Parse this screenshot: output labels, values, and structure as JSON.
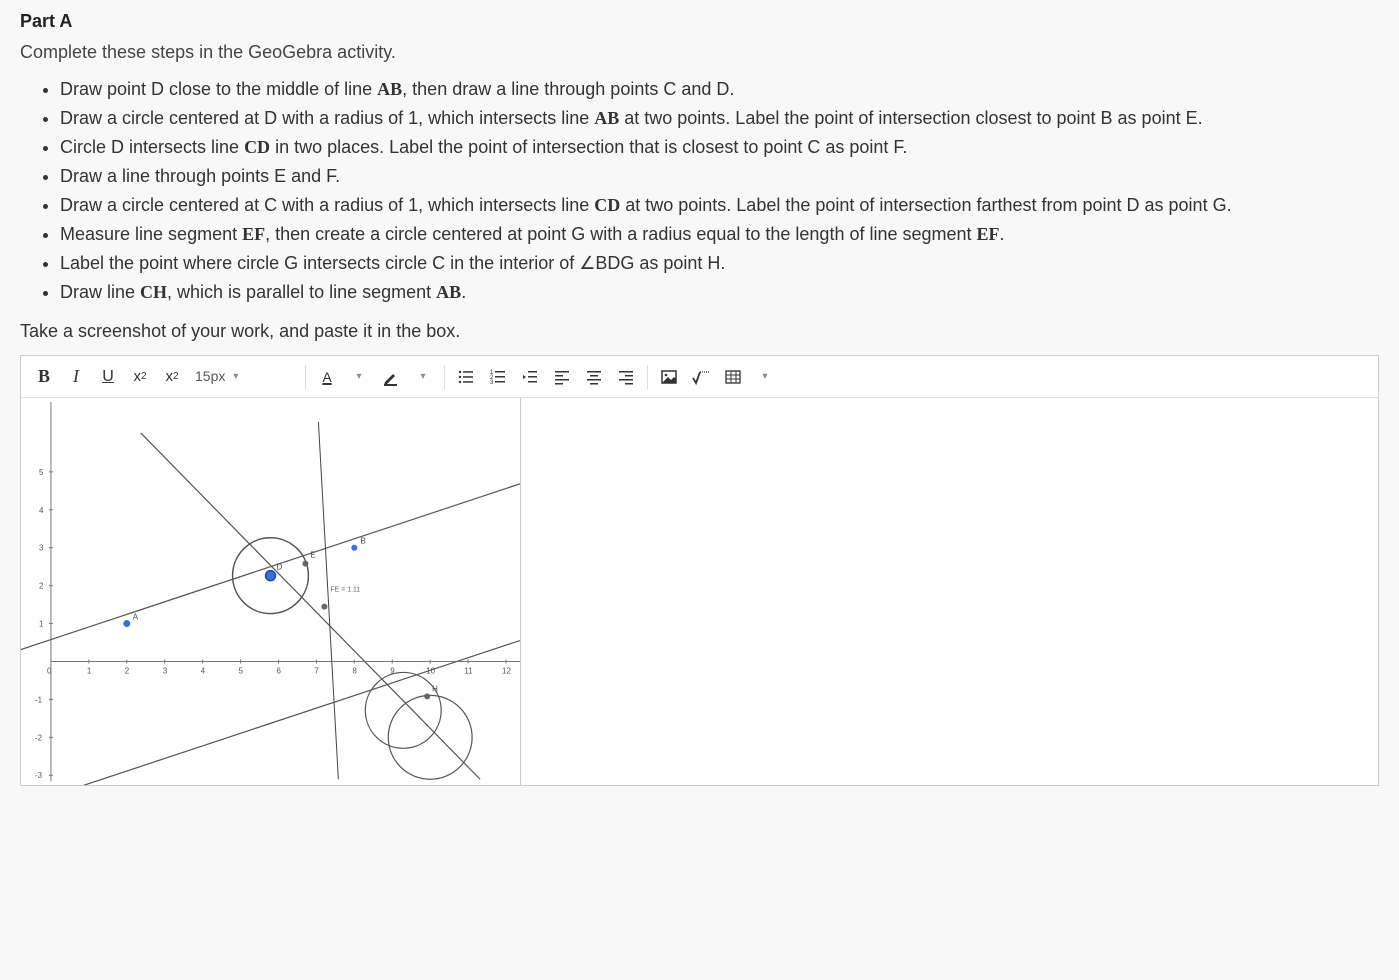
{
  "header": {
    "part": "Part A",
    "intro": "Complete these steps in the GeoGebra activity."
  },
  "steps": [
    {
      "pre": "Draw point D close to the middle of line ",
      "b1": "AB",
      "post1": ", then draw a line through points C and D."
    },
    {
      "pre": "Draw a circle centered at D with a radius of 1, which intersects line ",
      "b1": "AB",
      "post1": " at two points. Label the point of intersection closest to point B as point E."
    },
    {
      "pre": "Circle D intersects line ",
      "b1": "CD",
      "post1": "  in two places. Label the point of intersection that is closest to point C as point F."
    },
    {
      "pre": "Draw a line through points E and F."
    },
    {
      "pre": "Draw a circle centered at C with a radius of 1, which intersects line ",
      "b1": "CD",
      "post1": "  at two points. Label the point of intersection farthest from point D as point G."
    },
    {
      "pre": "Measure line segment ",
      "b1": "EF",
      "post1": ", then create a circle centered at point G with a radius equal to the length of line segment ",
      "b2": "EF",
      "post2": "."
    },
    {
      "pre": "Label the point where circle G intersects circle C in the interior of ",
      "ang": "BDG",
      "post1": "  as point H."
    },
    {
      "pre": "Draw line ",
      "b1": "CH",
      "post1": ", which is parallel to line segment ",
      "b2": "AB",
      "post2": "."
    }
  ],
  "closing": "Take a screenshot of your work, and paste it in the box.",
  "toolbar": {
    "bold": "B",
    "italic": "I",
    "underline": "U",
    "sup": "x",
    "sup2": "2",
    "sub": "x",
    "sub2": "2",
    "fontsize": "15px",
    "fontcolor": "A"
  },
  "geo": {
    "xticks": [
      "0",
      "1",
      "2",
      "3",
      "4",
      "5",
      "6",
      "7",
      "8",
      "9",
      "10",
      "11",
      "12"
    ],
    "yticks": [
      "-3",
      "-2",
      "-1",
      "1",
      "2",
      "3",
      "4",
      "5"
    ],
    "labels": {
      "A": "A",
      "B": "B",
      "D": "D",
      "E": "E",
      "H": "H"
    },
    "measure": "FE = 1.11"
  }
}
